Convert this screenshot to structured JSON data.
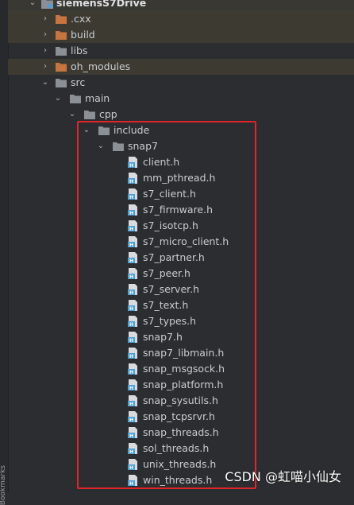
{
  "side_gutter": {
    "label": "Bookmarks"
  },
  "root": {
    "label": "siemensS7Drive"
  },
  "folders": {
    "cxx": ".cxx",
    "build": "build",
    "libs": "libs",
    "oh_modules": "oh_modules",
    "src": "src",
    "main": "main",
    "cpp": "cpp",
    "include": "include",
    "snap7": "snap7"
  },
  "files": [
    "client.h",
    "mm_pthread.h",
    "s7_client.h",
    "s7_firmware.h",
    "s7_isotcp.h",
    "s7_micro_client.h",
    "s7_partner.h",
    "s7_peer.h",
    "s7_server.h",
    "s7_text.h",
    "s7_types.h",
    "snap7.h",
    "snap7_libmain.h",
    "snap_msgsock.h",
    "snap_platform.h",
    "snap_sysutils.h",
    "snap_tcpsrvr.h",
    "snap_threads.h",
    "sol_threads.h",
    "unix_threads.h",
    "win_threads.h"
  ],
  "colors": {
    "excluded_folder": "#c6753f",
    "normal_folder": "#8b8f96",
    "header_file": "#4aa0d8",
    "highlight_border": "#e0252b"
  },
  "watermark": "CSDN @虹喵小仙女"
}
